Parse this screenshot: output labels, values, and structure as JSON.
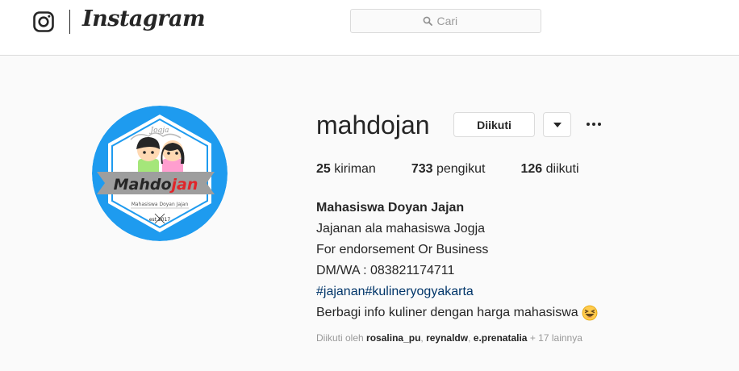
{
  "header": {
    "app_name": "Instagram",
    "logo_icon": "instagram-camera-icon",
    "search": {
      "placeholder": "Cari",
      "icon": "search-icon"
    }
  },
  "profile": {
    "avatar_brand": "Mahdojan",
    "avatar_place": "Jogja",
    "avatar_tagline": "Mahasiswa Doyan Jajan",
    "avatar_est": "est 2017",
    "username": "mahdojan",
    "follow_label": "Diikuti",
    "stats": [
      {
        "count": "25",
        "label": "kiriman"
      },
      {
        "count": "733",
        "label": "pengikut"
      },
      {
        "count": "126",
        "label": "diikuti"
      }
    ],
    "bio": {
      "full_name": "Mahasiswa Doyan Jajan",
      "lines": [
        "Jajanan ala mahasiswa Jogja",
        "For endorsement Or Business",
        "DM/WA : 083821174711"
      ],
      "hashtags": [
        "#jajanan",
        "#kulineryogyakarta"
      ],
      "last_line": "Berbagi info kuliner dengan harga mahasiswa",
      "emoji": "laughing-face-emoji"
    },
    "followed_by": {
      "prefix": "Diikuti oleh",
      "users": [
        "rosalina_pu",
        "reynaldw",
        "e.prenatalia"
      ],
      "more": "+ 17 lainnya"
    }
  },
  "colors": {
    "avatar_blue": "#1e9bef",
    "link": "#003569",
    "brand_red": "#e0252a"
  }
}
